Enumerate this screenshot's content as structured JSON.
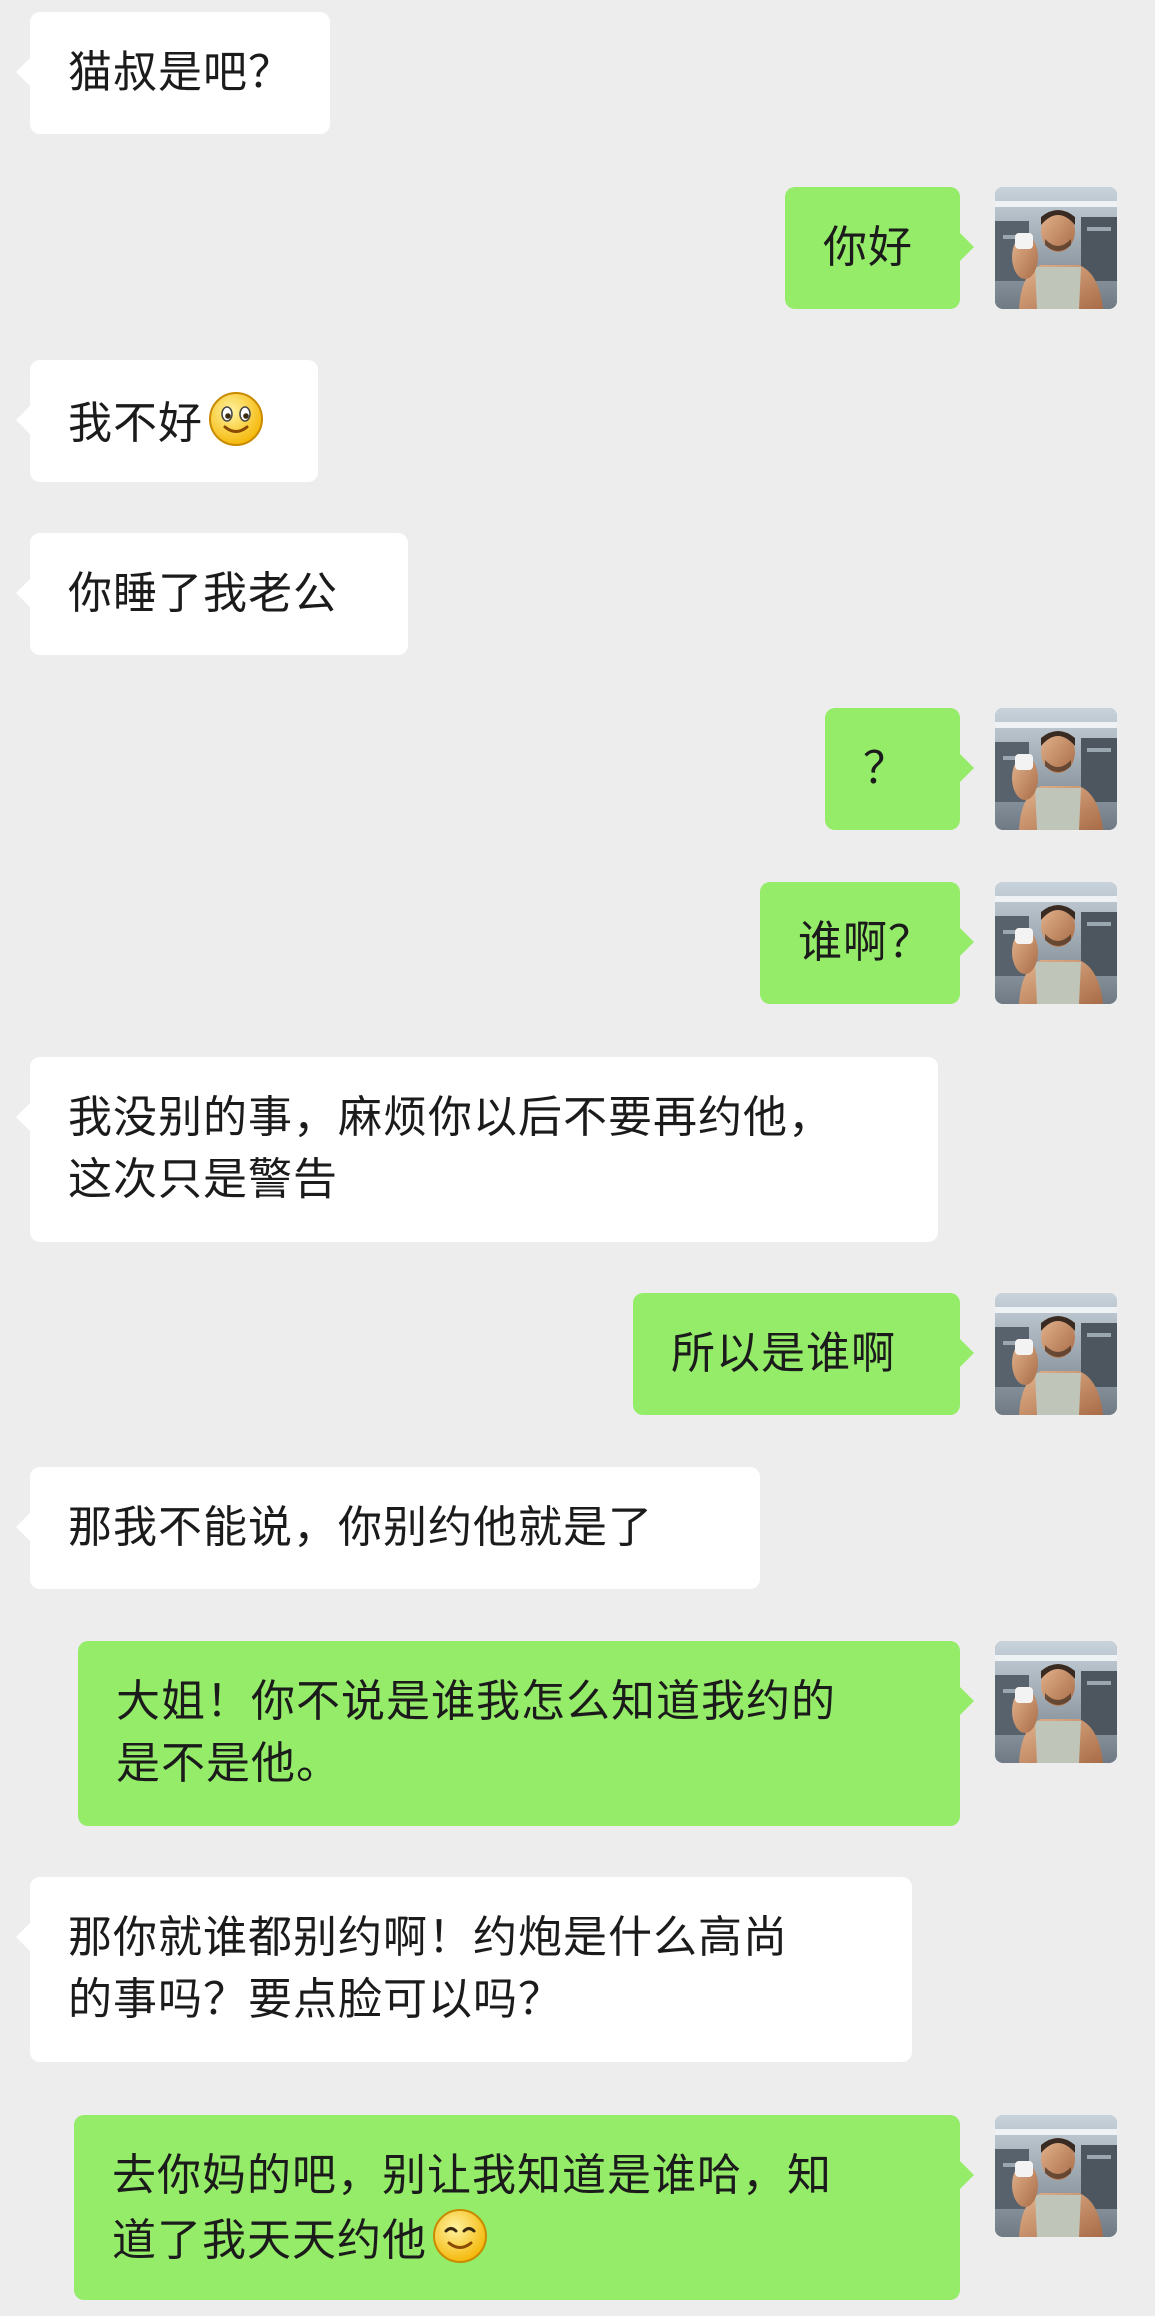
{
  "messages": [
    {
      "side": "in",
      "lines": [
        "猫叔是吧？"
      ]
    },
    {
      "side": "out",
      "lines": [
        "你好"
      ]
    },
    {
      "side": "in",
      "lines": [
        "我不好"
      ],
      "emoji": "smile-emoji"
    },
    {
      "side": "in",
      "lines": [
        "你睡了我老公"
      ]
    },
    {
      "side": "out",
      "lines": [
        "？"
      ]
    },
    {
      "side": "out",
      "lines": [
        "谁啊？"
      ]
    },
    {
      "side": "in",
      "lines": [
        "我没别的事，麻烦你以后不要再约他，",
        "这次只是警告"
      ]
    },
    {
      "side": "out",
      "lines": [
        "所以是谁啊"
      ]
    },
    {
      "side": "in",
      "lines": [
        "那我不能说，你别约他就是了"
      ]
    },
    {
      "side": "out",
      "lines": [
        "大姐！你不说是谁我怎么知道我约的",
        "是不是他。"
      ]
    },
    {
      "side": "in",
      "lines": [
        "那你就谁都别约啊！约炮是什么高尚",
        "的事吗？要点脸可以吗？"
      ]
    },
    {
      "side": "out",
      "lines": [
        "去你妈的吧，别让我知道是谁哈，知",
        "道了我天天约他"
      ],
      "emoji": "smile-emoji"
    }
  ],
  "avatar_icon": "user-avatar-gym-photo",
  "colors": {
    "background": "#ededed",
    "incoming_bubble": "#ffffff",
    "outgoing_bubble": "#95ec69",
    "text": "#1b1b1b"
  }
}
